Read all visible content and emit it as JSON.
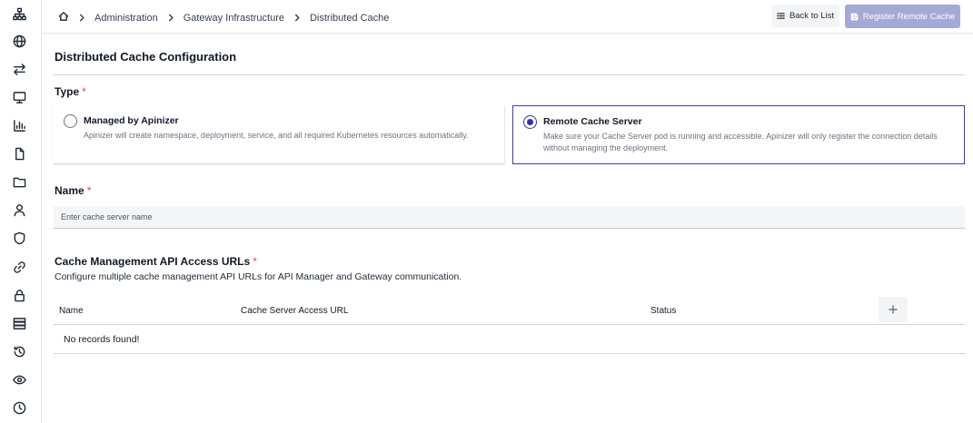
{
  "breadcrumb": {
    "items": [
      "Administration",
      "Gateway Infrastructure",
      "Distributed Cache"
    ]
  },
  "toolbar": {
    "back_label": "Back to List",
    "register_label": "Register Remote Cache"
  },
  "form": {
    "title": "Distributed Cache Configuration",
    "type_label": "Type",
    "required_mark": "*",
    "options": [
      {
        "title": "Managed by Apinizer",
        "description": "Apinizer will create namespace, deployment, service, and all required Kubernetes resources automatically.",
        "selected": false
      },
      {
        "title": "Remote Cache Server",
        "description": "Make sure your Cache Server pod is running and accessible. Apinizer will only register the connection details without managing the deployment.",
        "selected": true
      }
    ],
    "name_label": "Name",
    "name_placeholder": "Enter cache server name",
    "name_value": "",
    "urls_label": "Cache Management API Access URLs",
    "urls_help": "Configure multiple cache management API URLs for API Manager and Gateway communication."
  },
  "table": {
    "columns": [
      "Name",
      "Cache Server Access URL",
      "Status"
    ],
    "rows": [],
    "empty_text": "No records found!"
  },
  "sidebar": {
    "icons": [
      "sitemap-icon",
      "globe-icon",
      "arrows-exchange-icon",
      "monitor-icon",
      "bar-chart-icon",
      "file-icon",
      "folder-icon",
      "user-icon",
      "shield-icon",
      "link-icon",
      "lock-icon",
      "server-list-icon",
      "history-icon",
      "eye-icon",
      "clock-icon"
    ]
  },
  "colors": {
    "accent": "#3730a3",
    "register_button_disabled": "#a5a9d6",
    "required": "#ef4444",
    "input_bg": "#f3f5f7"
  }
}
